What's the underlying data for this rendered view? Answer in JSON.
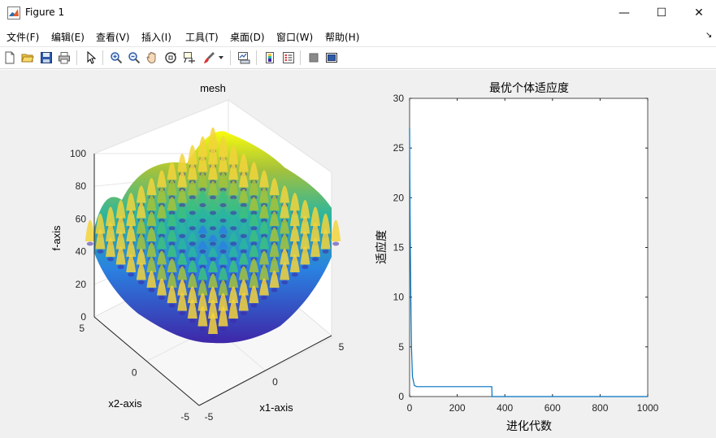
{
  "window": {
    "title": "Figure 1",
    "minimize_glyph": "—",
    "maximize_glyph": "☐",
    "close_glyph": "✕"
  },
  "menu": {
    "items": [
      "文件(F)",
      "编辑(E)",
      "查看(V)",
      "插入(I)",
      "工具(T)",
      "桌面(D)",
      "窗口(W)",
      "帮助(H)"
    ],
    "overflow_glyph": "↘"
  },
  "toolbar": {
    "buttons": [
      "new-figure-icon",
      "open-file-icon",
      "save-icon",
      "print-icon",
      "pointer-icon",
      "zoom-in-icon",
      "zoom-out-icon",
      "pan-icon",
      "rotate-3d-icon",
      "data-cursor-icon",
      "brush-icon",
      "link-plot-icon",
      "colorbar-icon",
      "legend-icon",
      "hide-plot-tools-icon",
      "show-plot-tools-icon"
    ]
  },
  "colors": {
    "canvas_bg": "#f0f0f0",
    "line": "#0072bd",
    "surface_low": "#3e26a8",
    "surface_mid": "#2ab5a0",
    "surface_high": "#f9fb0e"
  },
  "chart_data": [
    {
      "type": "surface",
      "title": "mesh",
      "xlabel": "x1-axis",
      "ylabel": "x2-axis",
      "zlabel": "f-axis",
      "xlim": [
        -5,
        5
      ],
      "ylim": [
        -5,
        5
      ],
      "zlim": [
        0,
        100
      ],
      "x_ticks": [
        "-5",
        "0",
        "5"
      ],
      "y_ticks": [
        "5",
        "0",
        "-5"
      ],
      "z_ticks": [
        "0",
        "20",
        "40",
        "60",
        "80",
        "100"
      ],
      "grid": true,
      "colormap": "parula"
    },
    {
      "type": "line",
      "title": "最优个体适应度",
      "xlabel": "进化代数",
      "ylabel": "适应度",
      "xlim": [
        0,
        1000
      ],
      "ylim": [
        0,
        30
      ],
      "x_ticks": [
        "0",
        "200",
        "400",
        "600",
        "800",
        "1000"
      ],
      "y_ticks": [
        "0",
        "5",
        "10",
        "15",
        "20",
        "25",
        "30"
      ],
      "series": [
        {
          "x": [
            0,
            1,
            2,
            3,
            5,
            8,
            12,
            20,
            30,
            60,
            100,
            200,
            300,
            345,
            346,
            400,
            600,
            800,
            1000
          ],
          "y": [
            27,
            22,
            18,
            15,
            10,
            5,
            2,
            1.1,
            1.0,
            1.0,
            1.0,
            1.0,
            1.0,
            1.0,
            0.0,
            0.0,
            0.0,
            0.0,
            0.0
          ]
        }
      ]
    }
  ]
}
